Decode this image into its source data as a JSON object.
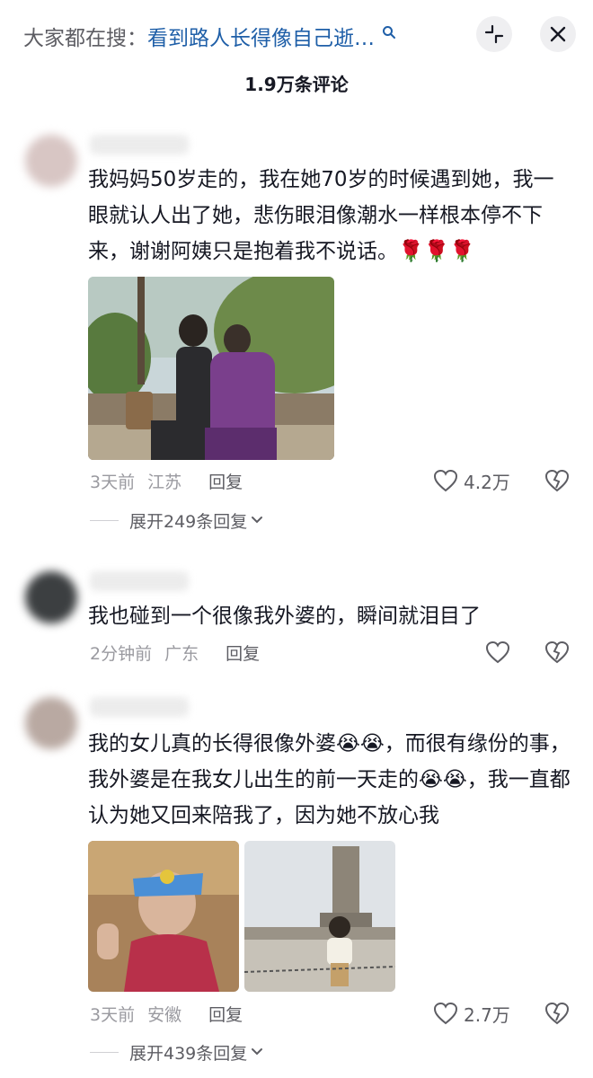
{
  "header": {
    "search_prefix": "大家都在搜：",
    "search_topic": "看到路人长得像自己逝…",
    "search_icon": "search-icon",
    "collapse_icon": "collapse-icon",
    "close_icon": "close-icon"
  },
  "comment_count": "1.9万条评论",
  "comments": [
    {
      "text": "我妈妈50岁走的，我在她70岁的时候遇到她，我一眼就认人出了她，悲伤眼泪像潮水一样根本停不下来，谢谢阿姨只是抱着我不说话。🌹🌹🌹",
      "time": "3天前",
      "location": "江苏",
      "reply": "回复",
      "likes": "4.2万",
      "expand": "展开249条回复"
    },
    {
      "text": "我也碰到一个很像我外婆的，瞬间就泪目了",
      "time": "2分钟前",
      "location": "广东",
      "reply": "回复",
      "likes": ""
    },
    {
      "text": "我的女儿真的长得很像外婆😭😭，而很有缘份的事，我外婆是在我女儿出生的前一天走的😭😭，我一直都认为她又回来陪我了，因为她不放心我",
      "time": "3天前",
      "location": "安徽",
      "reply": "回复",
      "likes": "2.7万",
      "expand": "展开439条回复"
    }
  ],
  "colors": {
    "link": "#1f5fa8",
    "text": "#161823",
    "secondary": "#9a9aa0"
  }
}
